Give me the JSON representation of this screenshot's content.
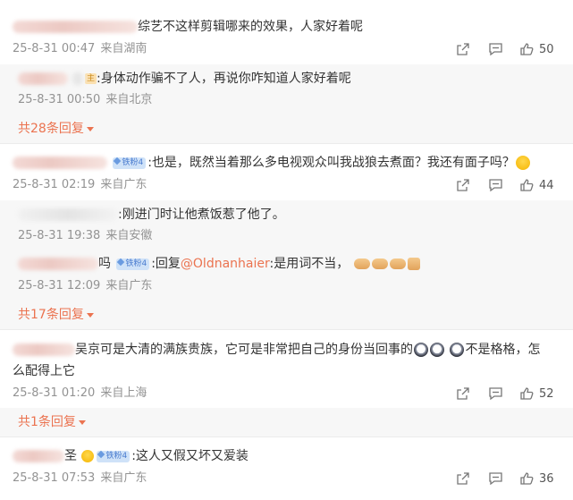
{
  "comments": [
    {
      "text": "综艺不这样剪辑哪来的效果，人家好着呢",
      "date": "25-8-31 00:47",
      "location": "来自湖南",
      "likes": "50",
      "replies": [
        {
          "text": ":身体动作骗不了人，再说你咋知道人家好着呢",
          "date": "25-8-31 00:50",
          "location": "来自北京"
        }
      ],
      "more": "共28条回复"
    },
    {
      "fan_badge": "铁粉4",
      "text": ":也是，既然当着那么多电视观众叫我战狼去煮面？我还有面子吗？",
      "date": "25-8-31 02:19",
      "location": "来自广东",
      "likes": "44",
      "replies": [
        {
          "text": ":刚进门时让他煮饭惹了他了。",
          "date": "25-8-31 19:38",
          "location": "来自安徽"
        },
        {
          "name_tail": "吗",
          "fan_badge": "铁粉4",
          "prefix": ":回复",
          "mention": "@Oldnanhaier",
          "text": ":是用词不当，",
          "date": "25-8-31 12:09",
          "location": "来自广东"
        }
      ],
      "more": "共17条回复"
    },
    {
      "text_line1": "吴京可是大清的满族贵族，它可是非常把自己的身份当回事的",
      "text_line1_tail": "不是格格，怎",
      "text_line2": "么配得上它",
      "date": "25-8-31 01:20",
      "location": "来自上海",
      "likes": "52",
      "more": "共1条回复"
    },
    {
      "name_tail": "圣",
      "fan_badge": "铁粉4",
      "text": ":这人又假又坏又爱装",
      "date": "25-8-31 07:53",
      "location": "来自广东",
      "likes": "36"
    }
  ],
  "icons": {
    "share": "share-icon",
    "comment": "comment-icon",
    "like": "thumbs-up-icon",
    "caret": "caret-down-icon"
  },
  "colors": {
    "accent": "#eb7350",
    "meta": "#939393",
    "reply_bg": "#f7f7f7"
  }
}
